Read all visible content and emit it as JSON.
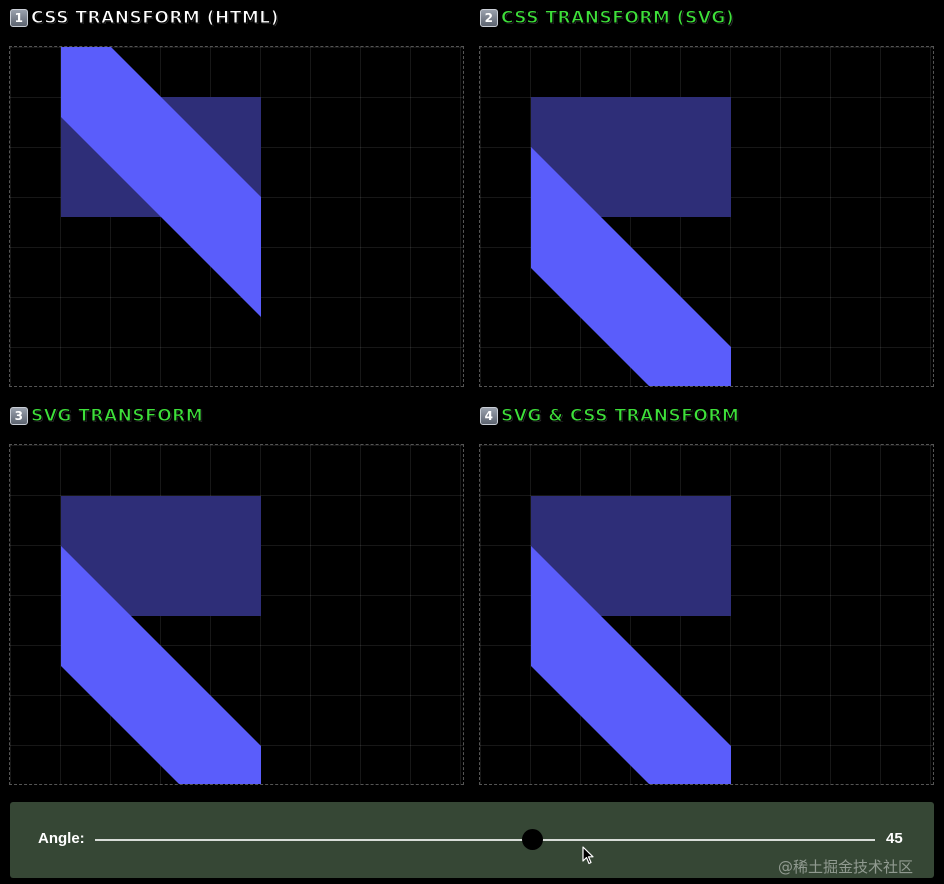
{
  "panels": [
    {
      "badge": "1",
      "title": "CSS TRANSFORM (HTML)",
      "title_color": "#ffffff"
    },
    {
      "badge": "2",
      "title": "CSS TRANSFORM (SVG)",
      "title_color": "#3ee03a"
    },
    {
      "badge": "3",
      "title": "SVG TRANSFORM",
      "title_color": "#3ee03a"
    },
    {
      "badge": "4",
      "title": "SVG & CSS TRANSFORM",
      "title_color": "#3ee03a"
    }
  ],
  "colors": {
    "shape_original": "#2e2e78",
    "shape_transformed": "#5a5dfb",
    "control_bar": "#364735",
    "grid_line": "rgba(255,255,255,0.09)"
  },
  "control": {
    "label": "Angle:",
    "value": "45",
    "min": 0,
    "max": 90,
    "current": 45
  },
  "watermark": "@稀土掘金技术社区"
}
